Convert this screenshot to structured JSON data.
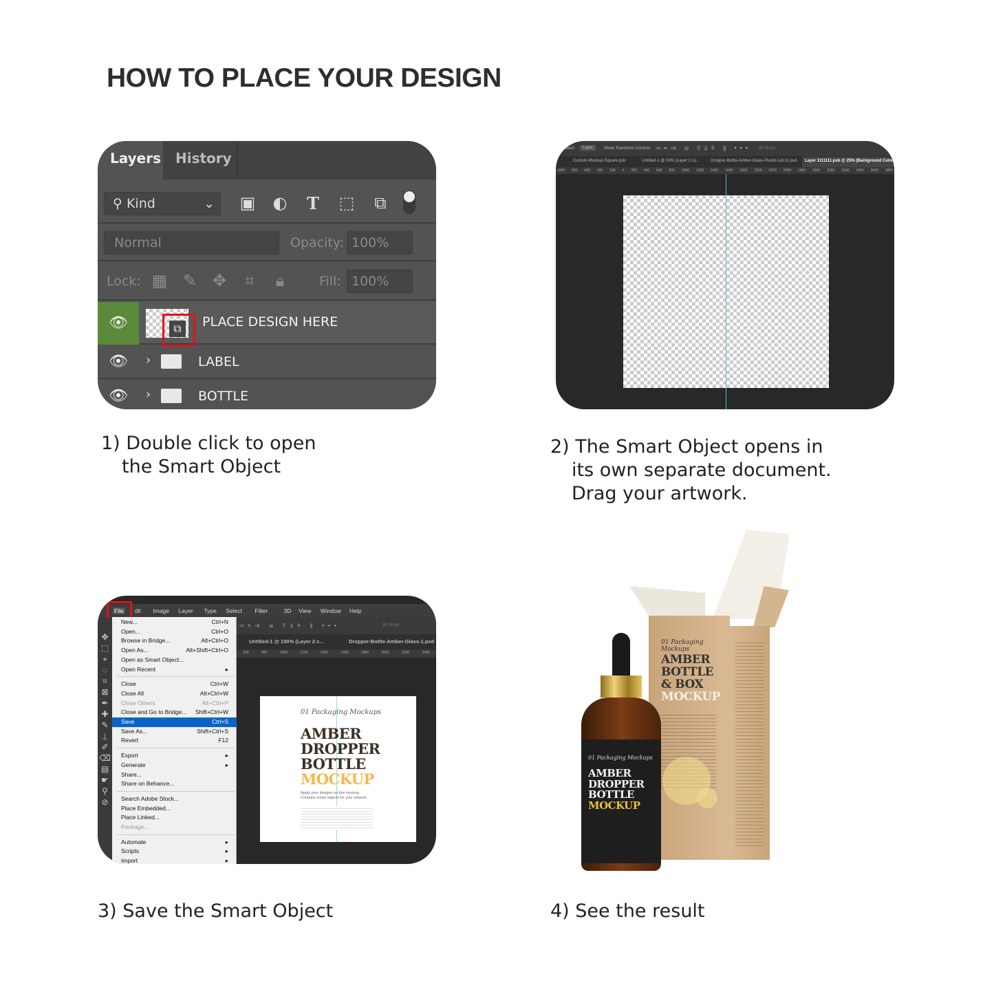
{
  "title": "HOW TO PLACE YOUR DESIGN",
  "steps": [
    {
      "caption_line1": "1) Double click to open",
      "caption_line2": "the Smart Object"
    },
    {
      "caption_line1": "2) The Smart Object opens in",
      "caption_line2": "its own separate document.",
      "caption_line3": "Drag your artwork."
    },
    {
      "caption_line1": "3) Save the Smart Object"
    },
    {
      "caption_line1": "4) See the result"
    }
  ],
  "layers_panel": {
    "tabs": [
      "Layers",
      "History"
    ],
    "filter_kind": "Kind",
    "blend_mode": "Normal",
    "opacity_label": "Opacity:",
    "opacity_value": "100%",
    "lock_label": "Lock:",
    "fill_label": "Fill:",
    "fill_value": "100%",
    "layers": [
      {
        "name": "PLACE DESIGN HERE",
        "type": "smart-object",
        "visible": true,
        "selected": true
      },
      {
        "name": "LABEL",
        "type": "group",
        "visible": true
      },
      {
        "name": "BOTTLE",
        "type": "group",
        "visible": true
      }
    ],
    "highlight_color": "#e0121b",
    "eye_active_color": "#5b8a3c"
  },
  "smart_object_doc": {
    "options": {
      "auto_select": "-Select:",
      "layer_select": "Layer",
      "transform_controls": "Show Transform Controls",
      "mode_3d": "3D Mode:"
    },
    "tabs": [
      "Custom-Mockup-Square.psb",
      "Untitled-1 @ 50% (Layer 2 co...",
      "Dropper-Bottle-Amber-Glass-Plastic-Lid-11.psd",
      "Layer 1111111.psb @ 25% (Background Color, RG"
    ],
    "ruler": [
      "1000",
      "800",
      "600",
      "400",
      "200",
      "0",
      "200",
      "400",
      "600",
      "800",
      "1000",
      "1200",
      "1400",
      "1600",
      "1800",
      "2000",
      "2200",
      "2400",
      "2600",
      "2800",
      "3000",
      "3200",
      "3400",
      "3600",
      "3800"
    ]
  },
  "save_step": {
    "menubar": [
      "File",
      "dit",
      "Image",
      "Layer",
      "Type",
      "Select",
      "Filter",
      "3D",
      "View",
      "Window",
      "Help"
    ],
    "mode_3d": "3D Mode:",
    "tabs": [
      "Untitled-1 @ 100% (Layer 2 c...",
      "Dropper-Bottle-Amber-Glass-1.psd"
    ],
    "ruler": [
      "600",
      "800",
      "1000",
      "1200",
      "1400",
      "1600",
      "1800",
      "2000",
      "2200",
      "2400"
    ],
    "file_menu": [
      {
        "label": "New...",
        "shortcut": "Ctrl+N"
      },
      {
        "label": "Open...",
        "shortcut": "Ctrl+O"
      },
      {
        "label": "Browse in Bridge...",
        "shortcut": "Alt+Ctrl+O"
      },
      {
        "label": "Open As...",
        "shortcut": "Alt+Shift+Ctrl+O"
      },
      {
        "label": "Open as Smart Object...",
        "shortcut": ""
      },
      {
        "label": "Open Recent",
        "shortcut": "▸",
        "sep_after": true
      },
      {
        "label": "Close",
        "shortcut": "Ctrl+W"
      },
      {
        "label": "Close All",
        "shortcut": "Alt+Ctrl+W"
      },
      {
        "label": "Close Others",
        "shortcut": "Alt+Ctrl+P",
        "disabled": true
      },
      {
        "label": "Close and Go to Bridge...",
        "shortcut": "Shift+Ctrl+W"
      },
      {
        "label": "Save",
        "shortcut": "Ctrl+S",
        "highlighted": true
      },
      {
        "label": "Save As...",
        "shortcut": "Shift+Ctrl+S"
      },
      {
        "label": "Revert",
        "shortcut": "F12",
        "sep_after": true
      },
      {
        "label": "Export",
        "shortcut": "▸"
      },
      {
        "label": "Generate",
        "shortcut": "▸"
      },
      {
        "label": "Share...",
        "shortcut": ""
      },
      {
        "label": "Share on Behance...",
        "shortcut": "",
        "sep_after": true
      },
      {
        "label": "Search Adobe Stock...",
        "shortcut": ""
      },
      {
        "label": "Place Embedded...",
        "shortcut": ""
      },
      {
        "label": "Place Linked...",
        "shortcut": ""
      },
      {
        "label": "Package...",
        "shortcut": "",
        "disabled": true,
        "sep_after": true
      },
      {
        "label": "Automate",
        "shortcut": "▸"
      },
      {
        "label": "Scripts",
        "shortcut": "▸"
      },
      {
        "label": "Import",
        "shortcut": "▸"
      }
    ],
    "artwork": {
      "script": "01 Packaging Mockups",
      "heading": [
        "AMBER",
        "DROPPER",
        "BOTTLE"
      ],
      "accent": "MOCKUP",
      "tagline1": "Apply your designs on this mockup.",
      "tagline2": "Contains smart objects for your artwork.",
      "accent_color": "#f6b84a"
    }
  },
  "result": {
    "bottle_label": {
      "script": "01 Packaging Mockups",
      "heading": [
        "AMBER",
        "DROPPER",
        "BOTTLE"
      ],
      "accent": "MOCKUP",
      "accent_color": "#e8c23a"
    },
    "box_label": {
      "script": "01 Packaging Mockups",
      "heading": [
        "AMBER",
        "BOTTLE",
        "& BOX"
      ],
      "accent": "MOCKUP"
    }
  }
}
